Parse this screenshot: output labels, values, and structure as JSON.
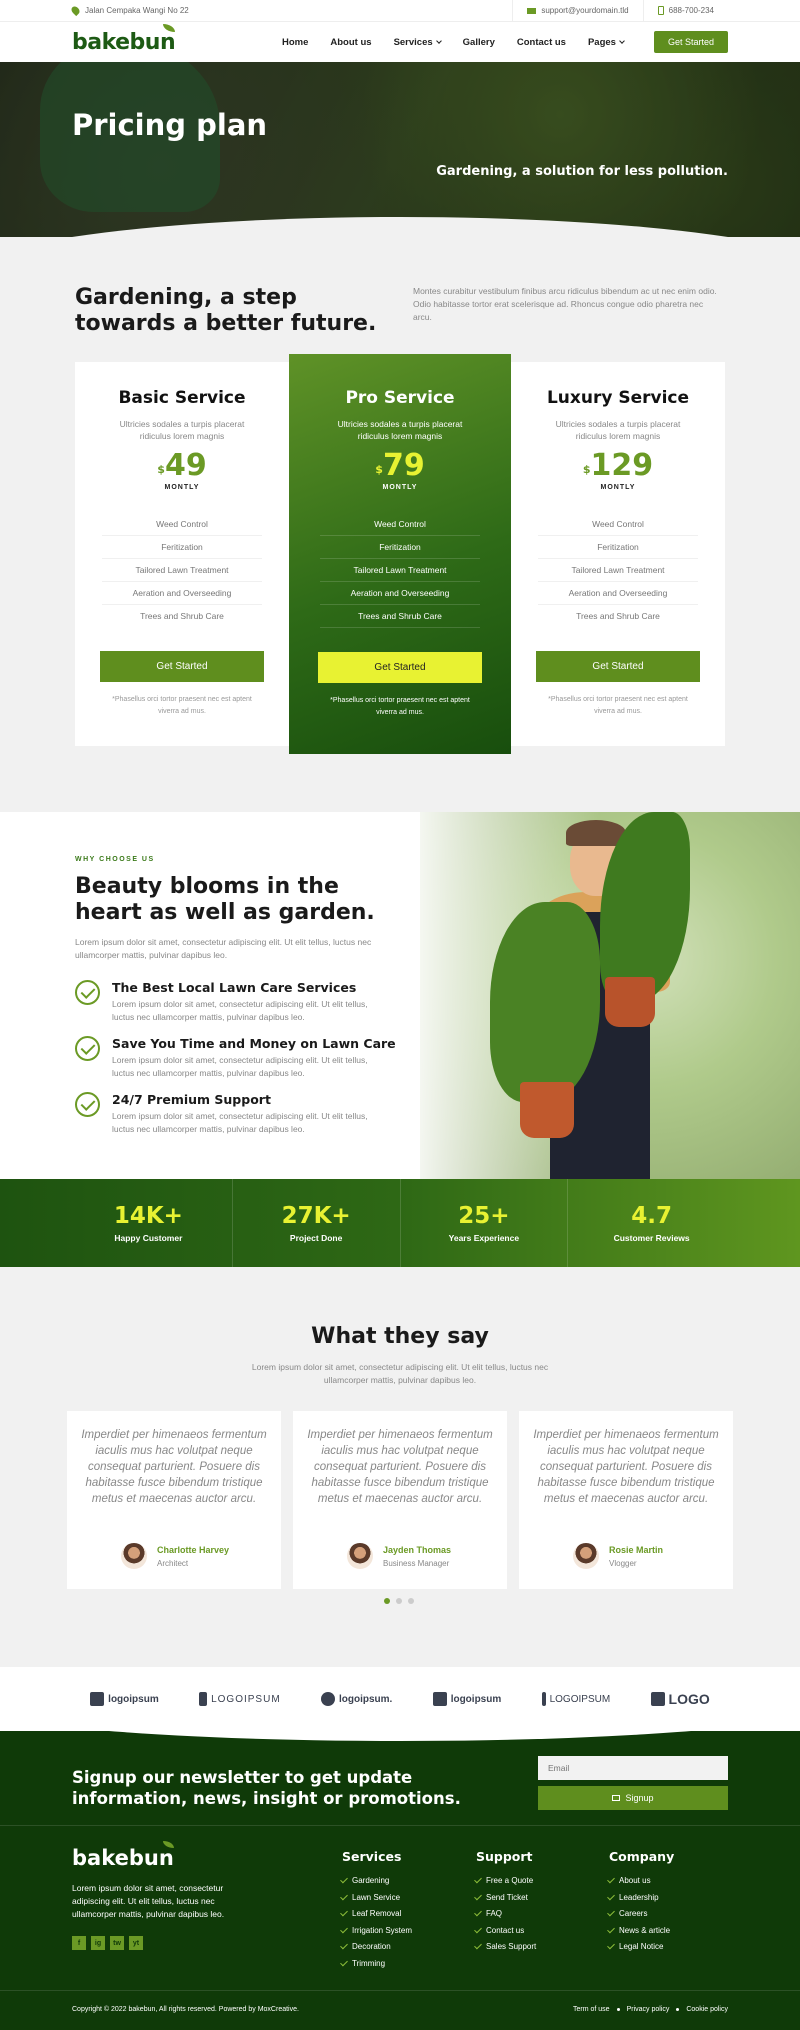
{
  "topbar": {
    "address": "Jalan Cempaka Wangi No 22",
    "email": "support@yourdomain.tld",
    "phone": "688-700-234"
  },
  "nav": {
    "logo": "bakebun",
    "items": [
      "Home",
      "About us",
      "Services",
      "Gallery",
      "Contact us",
      "Pages"
    ],
    "cta": "Get Started"
  },
  "hero": {
    "title": "Pricing plan",
    "tagline": "Gardening, a solution for less pollution."
  },
  "pricing": {
    "heading": "Gardening, a step towards a better future.",
    "intro": "Montes curabitur vestibulum finibus arcu ridiculus bibendum ac ut nec enim odio. Odio habitasse tortor erat scelerisque ad. Rhoncus congue odio pharetra nec arcu.",
    "plans": [
      {
        "name": "Basic Service",
        "desc": "Ultricies sodales a turpis placerat ridiculus lorem magnis",
        "currency": "$",
        "price": "49",
        "period": "MONTLY",
        "features": [
          "Weed Control",
          "Feritization",
          "Tailored Lawn Treatment",
          "Aeration and Overseeding",
          "Trees and Shrub Care"
        ],
        "button": "Get Started",
        "note": "*Phasellus orci tortor praesent nec est aptent viverra ad mus."
      },
      {
        "name": "Pro Service",
        "desc": "Ultricies sodales a turpis placerat ridiculus lorem magnis",
        "currency": "$",
        "price": "79",
        "period": "MONTLY",
        "features": [
          "Weed Control",
          "Feritization",
          "Tailored Lawn Treatment",
          "Aeration and Overseeding",
          "Trees and Shrub Care"
        ],
        "button": "Get Started",
        "note": "*Phasellus orci tortor praesent nec est aptent viverra ad mus."
      },
      {
        "name": "Luxury Service",
        "desc": "Ultricies sodales a turpis placerat ridiculus lorem magnis",
        "currency": "$",
        "price": "129",
        "period": "MONTLY",
        "features": [
          "Weed Control",
          "Feritization",
          "Tailored Lawn Treatment",
          "Aeration and Overseeding",
          "Trees and Shrub Care"
        ],
        "button": "Get Started",
        "note": "*Phasellus orci tortor praesent nec est aptent viverra ad mus."
      }
    ]
  },
  "why": {
    "kicker": "WHY CHOOSE US",
    "heading": "Beauty blooms in the heart as well as garden.",
    "lead": "Lorem ipsum dolor sit amet, consectetur adipiscing elit. Ut elit tellus, luctus nec ullamcorper mattis, pulvinar dapibus leo.",
    "items": [
      {
        "title": "The Best Local Lawn Care Services",
        "text": "Lorem ipsum dolor sit amet, consectetur adipiscing elit. Ut elit tellus, luctus nec ullamcorper mattis, pulvinar dapibus leo."
      },
      {
        "title": "Save You Time and Money on Lawn Care",
        "text": "Lorem ipsum dolor sit amet, consectetur adipiscing elit. Ut elit tellus, luctus nec ullamcorper mattis, pulvinar dapibus leo."
      },
      {
        "title": "24/7 Premium Support",
        "text": "Lorem ipsum dolor sit amet, consectetur adipiscing elit. Ut elit tellus, luctus nec ullamcorper mattis, pulvinar dapibus leo."
      }
    ]
  },
  "stats": [
    {
      "value": "14K+",
      "label": "Happy Customer"
    },
    {
      "value": "27K+",
      "label": "Project Done"
    },
    {
      "value": "25+",
      "label": "Years Experience"
    },
    {
      "value": "4.7",
      "label": "Customer Reviews"
    }
  ],
  "testimonials": {
    "heading": "What they say",
    "sub": "Lorem ipsum dolor sit amet, consectetur adipiscing elit. Ut elit tellus, luctus nec ullamcorper mattis, pulvinar dapibus leo.",
    "items": [
      {
        "quote": "Imperdiet per himenaeos fermentum iaculis mus hac volutpat neque consequat parturient. Posuere dis habitasse fusce bibendum tristique metus et maecenas auctor arcu.",
        "name": "Charlotte Harvey",
        "role": "Architect"
      },
      {
        "quote": "Imperdiet per himenaeos fermentum iaculis mus hac volutpat neque consequat parturient. Posuere dis habitasse fusce bibendum tristique metus et maecenas auctor arcu.",
        "name": "Jayden Thomas",
        "role": "Business Manager"
      },
      {
        "quote": "Imperdiet per himenaeos fermentum iaculis mus hac volutpat neque consequat parturient. Posuere dis habitasse fusce bibendum tristique metus et maecenas auctor arcu.",
        "name": "Rosie Martin",
        "role": "Vlogger"
      }
    ]
  },
  "logos": [
    "logoipsum",
    "LOGOIPSUM",
    "logoipsum.",
    "logoipsum",
    "LOGOIPSUM",
    "LOGO"
  ],
  "newsletter": {
    "heading": "Signup our newsletter to get update information, news, insight or promotions.",
    "placeholder": "Email",
    "button": "Signup"
  },
  "footer": {
    "logo": "bakebun",
    "desc": "Lorem ipsum dolor sit amet, consectetur adipiscing elit. Ut elit tellus, luctus nec ullamcorper mattis, pulvinar dapibus leo.",
    "social": [
      "f",
      "ig",
      "tw",
      "yt"
    ],
    "columns": [
      {
        "title": "Services",
        "links": [
          "Gardening",
          "Lawn Service",
          "Leaf Removal",
          "Irrigation System",
          "Decoration",
          "Trimming"
        ]
      },
      {
        "title": "Support",
        "links": [
          "Free a Quote",
          "Send Ticket",
          "FAQ",
          "Contact us",
          "Sales Support"
        ]
      },
      {
        "title": "Company",
        "links": [
          "About us",
          "Leadership",
          "Careers",
          "News & article",
          "Legal Notice"
        ]
      }
    ],
    "copyright": "Copyright © 2022 bakebun, All rights reserved. Powered by MoxCreative.",
    "legal": [
      "Term of use",
      "Privacy policy",
      "Cookie policy"
    ]
  },
  "colors": {
    "accent": "#6b9a25",
    "dark_green": "#0f3a08",
    "highlight": "#e8f232"
  }
}
